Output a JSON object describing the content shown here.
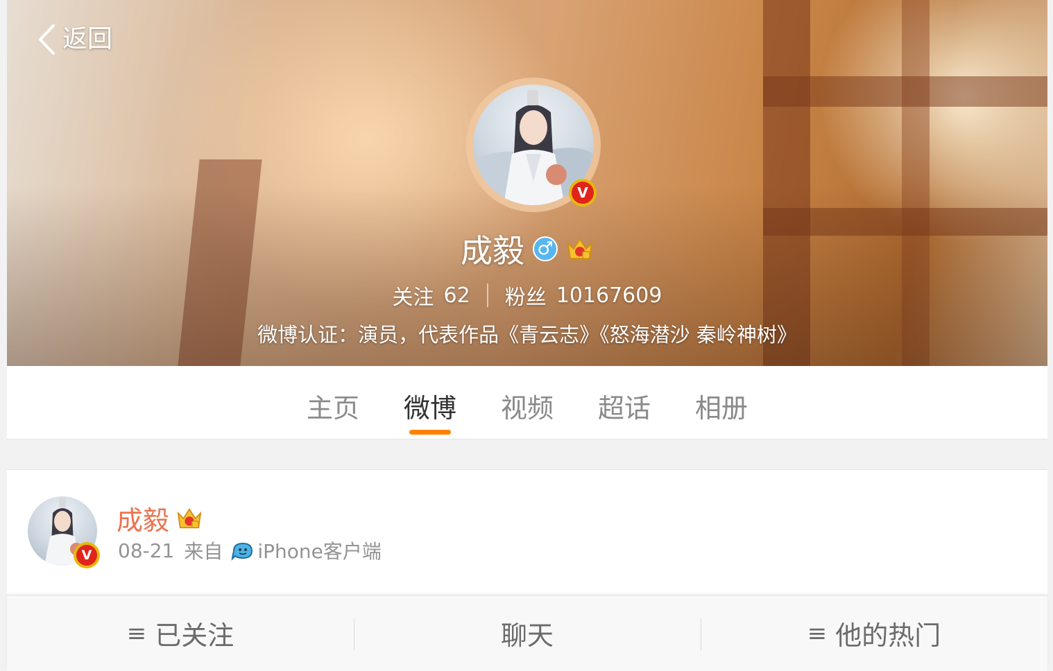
{
  "header": {
    "back_label": "返回",
    "name": "成毅",
    "gender_symbol": "♂",
    "badge_letter": "V",
    "stats": {
      "following_label": "关注",
      "following_count": "62",
      "followers_label": "粉丝",
      "followers_count": "10167609"
    },
    "verification": "微博认证：演员，代表作品《青云志》《怒海潜沙 秦岭神树》"
  },
  "tabs": [
    {
      "label": "主页",
      "active": false
    },
    {
      "label": "微博",
      "active": true
    },
    {
      "label": "视频",
      "active": false
    },
    {
      "label": "超话",
      "active": false
    },
    {
      "label": "相册",
      "active": false
    }
  ],
  "post": {
    "author": "成毅",
    "time": "08-21",
    "from_label": "来自",
    "client": "iPhone客户端",
    "badge_letter": "V"
  },
  "bottom_bar": {
    "follow_label": "已关注",
    "chat_label": "聊天",
    "hot_label": "他的热门"
  },
  "colors": {
    "accent": "#ff8200",
    "author_name": "#eb7350",
    "verified_badge": "#e0241b",
    "gender_male": "#57b6f0"
  },
  "icons": [
    "back-chevron-icon",
    "verified-v-icon",
    "male-gender-icon",
    "vip-crown-icon",
    "iphone-client-icon",
    "menu-icon"
  ]
}
